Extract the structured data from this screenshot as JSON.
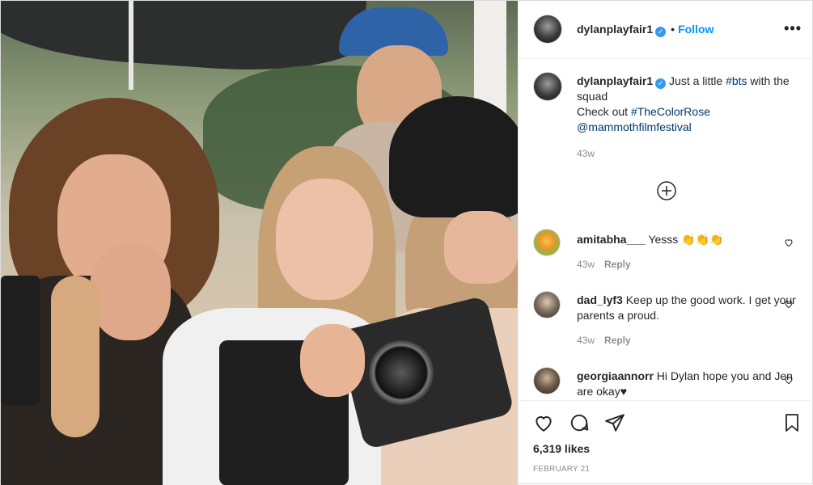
{
  "post": {
    "author": "dylanplayfair1",
    "follow_label": "Follow",
    "dot": "•",
    "more_label": "•••"
  },
  "caption": {
    "username": "dylanplayfair1",
    "text_before": "Just a little ",
    "hashtag_bts": "#bts",
    "text_after": " with the squad",
    "line2_prefix": "Check out ",
    "hashtag_film": "#TheColorRose",
    "mention": "@mammothfilmfestival",
    "time": "43w"
  },
  "comments": [
    {
      "username": "amitabha___",
      "text": "Yesss 👏👏👏",
      "time": "43w",
      "reply_label": "Reply"
    },
    {
      "username": "dad_lyf3",
      "text": "Keep up the good work. I get your parents a proud.",
      "time": "43w",
      "reply_label": "Reply"
    },
    {
      "username": "georgiaannorr",
      "text": "Hi Dylan hope you and Jen are okay♥"
    }
  ],
  "footer": {
    "likes": "6,319 likes",
    "date": "FEBRUARY 21"
  },
  "icons": {
    "load_more": "plus-circle-icon",
    "like": "heart-icon",
    "comment": "comment-icon",
    "share": "share-icon",
    "save": "bookmark-icon"
  },
  "colors": {
    "link_blue": "#0095f6",
    "hashtag_blue": "#00376b",
    "muted": "#8e8e8e",
    "text": "#262626"
  }
}
